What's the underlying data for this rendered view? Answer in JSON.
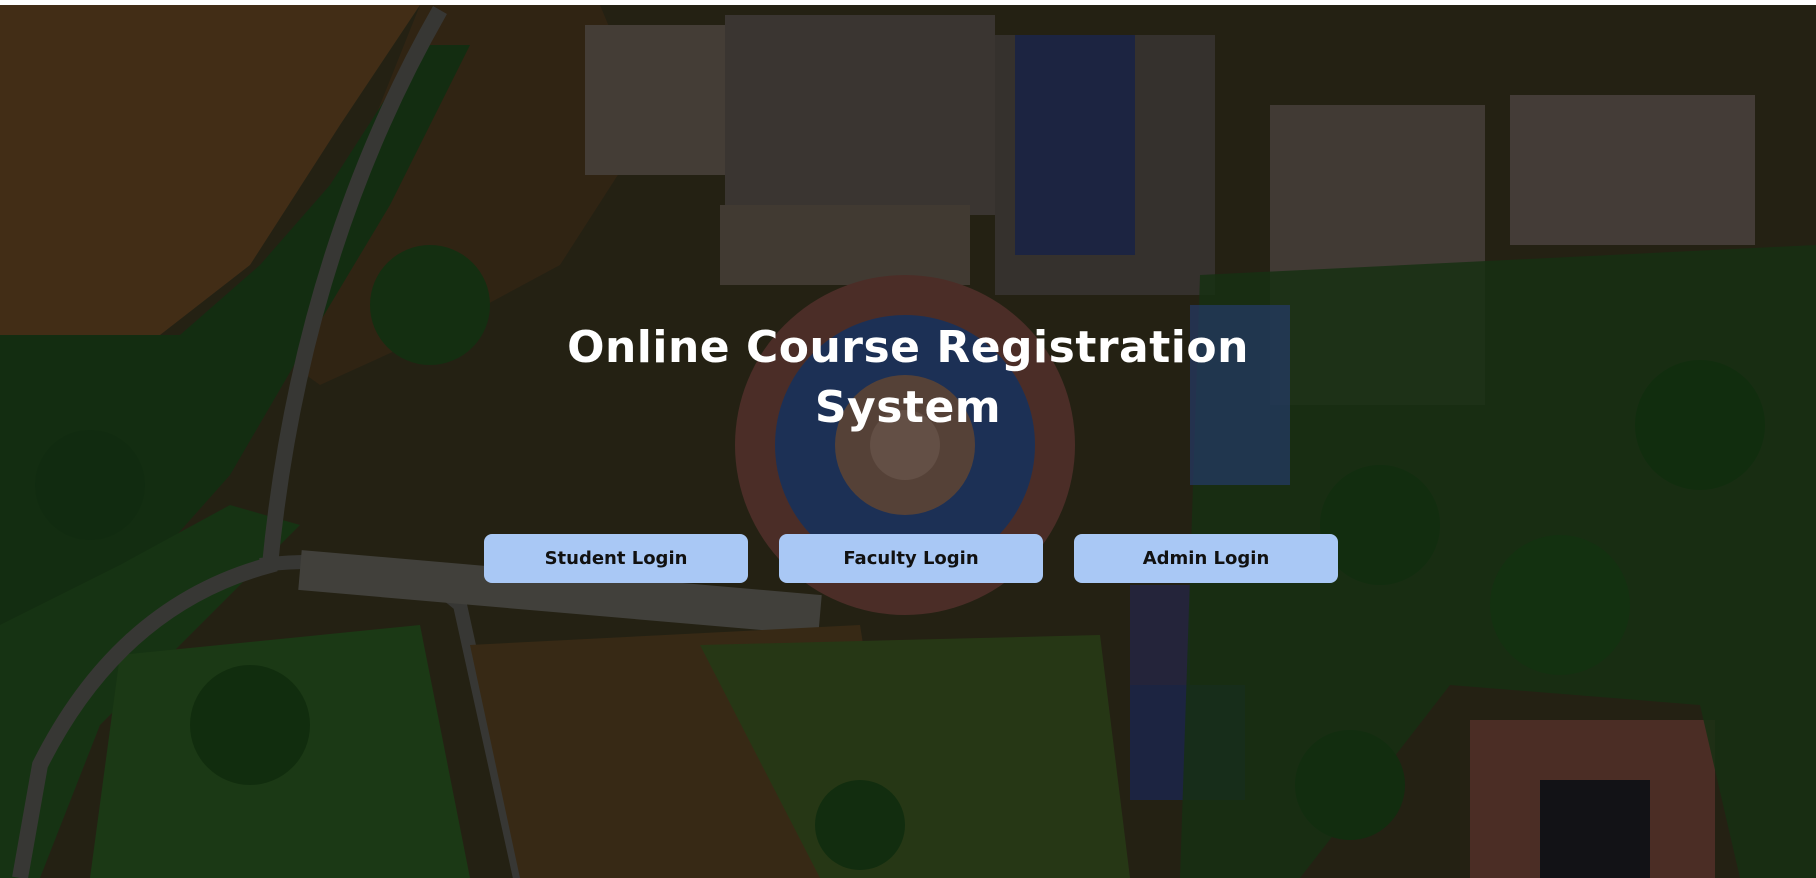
{
  "page": {
    "title_line1": "Online Course Registration",
    "title_line2": "System"
  },
  "buttons": {
    "student": "Student Login",
    "faculty": "Faculty Login",
    "admin": "Admin Login"
  },
  "colors": {
    "button_bg": "#a9c8f5",
    "title_text": "#ffffff"
  }
}
